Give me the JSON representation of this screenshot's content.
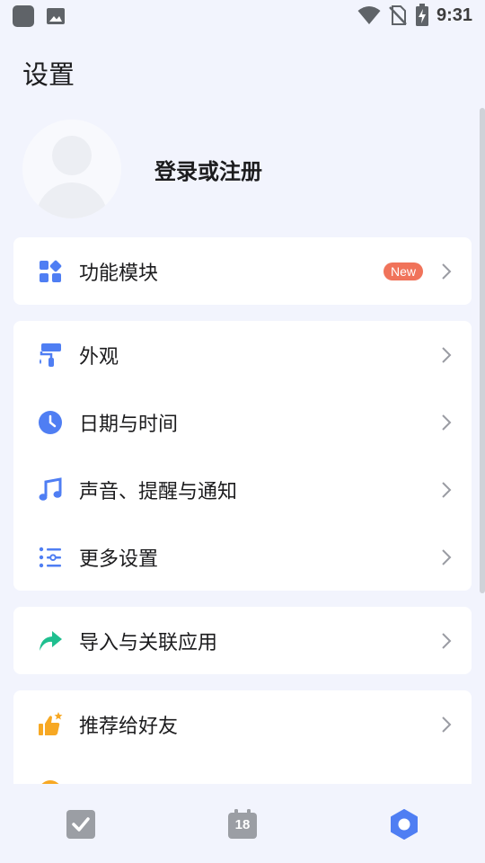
{
  "status_bar": {
    "time": "9:31"
  },
  "page": {
    "title": "设置"
  },
  "profile": {
    "login_label": "登录或注册"
  },
  "sections": [
    {
      "items": [
        {
          "label": "功能模块",
          "badge": "New"
        }
      ]
    },
    {
      "items": [
        {
          "label": "外观"
        },
        {
          "label": "日期与时间"
        },
        {
          "label": "声音、提醒与通知"
        },
        {
          "label": "更多设置"
        }
      ]
    },
    {
      "items": [
        {
          "label": "导入与关联应用"
        }
      ]
    },
    {
      "items": [
        {
          "label": "推荐给好友"
        }
      ]
    }
  ],
  "bottom_nav": {
    "calendar_day": "18"
  },
  "colors": {
    "accent": "#4f7ef3",
    "green": "#1fbf8f",
    "orange": "#f7a823",
    "badge": "#f0735a",
    "background": "#f2f4fd"
  }
}
